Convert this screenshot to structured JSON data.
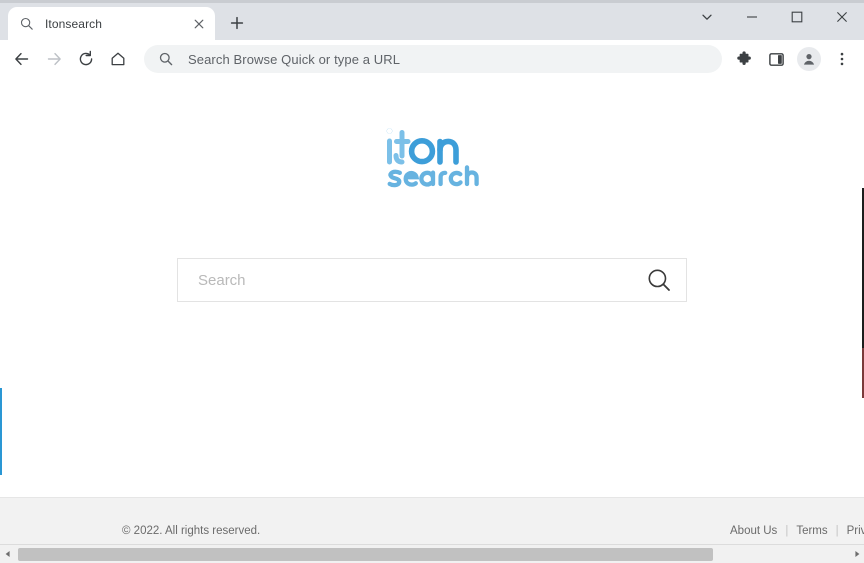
{
  "window": {
    "controls": {
      "tab_search": "tab-search-chevron",
      "minimize": "minimize",
      "maximize": "maximize",
      "close": "close"
    }
  },
  "tabstrip": {
    "tabs": [
      {
        "title": "Itonsearch",
        "favicon": "magnifier-icon",
        "close_label": "close-tab"
      }
    ],
    "new_tab_label": "new-tab"
  },
  "toolbar": {
    "back_label": "back",
    "forward_label": "forward",
    "reload_label": "reload",
    "home_label": "home",
    "omnibox": {
      "icon": "search-icon",
      "placeholder": "Search Browse Quick or type a URL",
      "value": ""
    },
    "extensions_label": "extensions",
    "side_panel_label": "side-panel",
    "profile_label": "profile",
    "menu_label": "chrome-menu"
  },
  "page": {
    "logo": {
      "line1_part1": "it",
      "line1_part2": "on",
      "line2": "search",
      "color_light": "#7cc0e8",
      "color_mid": "#4aa8de",
      "color_dark": "#2f93d6",
      "color_word2": "#67b3e0"
    },
    "search": {
      "placeholder": "Search",
      "value": "",
      "submit_icon": "magnifier-icon"
    },
    "footer": {
      "copyright": "© 2022. All rights reserved.",
      "links": [
        {
          "label": "About Us"
        },
        {
          "label": "Terms"
        },
        {
          "label": "Privac"
        }
      ],
      "separator": "|"
    }
  },
  "scrollbar": {
    "left_arrow": "scroll-left",
    "right_arrow": "scroll-right"
  }
}
